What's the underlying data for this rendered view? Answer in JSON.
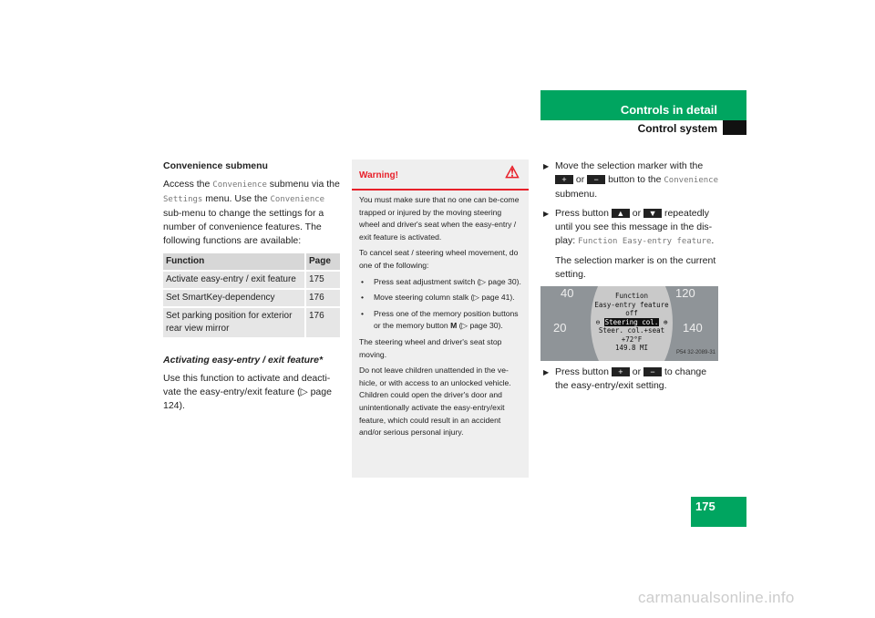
{
  "header": {
    "section": "Controls in detail",
    "subsection": "Control system"
  },
  "page_number": "175",
  "left": {
    "heading": "Convenience submenu",
    "intro": {
      "a": "Access the ",
      "m1": "Convenience",
      "b": " submenu via the ",
      "m2": "Settings",
      "c": " menu. Use the ",
      "m3": "Convenience",
      "d": " sub-menu to change the settings for a number of convenience features. The following functions are available:"
    },
    "table": {
      "headers": [
        "Function",
        "Page"
      ],
      "rows": [
        [
          "Activate easy-entry / exit feature",
          "175"
        ],
        [
          "Set SmartKey-dependency",
          "176"
        ],
        [
          "Set parking position for exterior rear view mirror",
          "176"
        ]
      ]
    },
    "subheading": "Activating easy-entry / exit feature",
    "subheading_mark": "*",
    "body": "Use this function to activate and deacti-vate the easy-entry/exit feature (▷ page 124)."
  },
  "warning": {
    "title": "Warning!",
    "icon": "warning-triangle-icon",
    "p1": "You must make sure that no one can be-come trapped or injured by the moving steering wheel and driver's seat when the easy-entry / exit feature is activated.",
    "p2": "To cancel seat / steering wheel movement, do one of the following:",
    "bullets": [
      "Press seat adjustment switch (▷ page 30).",
      "Move steering column stalk (▷ page 41).",
      "Press one of the memory position buttons or the memory button "
    ],
    "bullet3_bold": "M",
    "bullet3_end": " (▷ page 30).",
    "p3": "The steering wheel and driver's seat stop moving.",
    "p4": "Do not leave children unattended in the ve-hicle, or with access to an unlocked vehicle. Children could open the driver's door and unintentionally activate the easy-entry/exit feature, which could result in an accident and/or serious personal injury."
  },
  "right": {
    "step1": {
      "a": "Move the selection marker with the ",
      "plus": "+",
      "or": " or ",
      "minus": "−",
      "b": " button to the ",
      "menu": "Convenience",
      "c": " submenu."
    },
    "step2": {
      "a": "Press button ",
      "up": "▲",
      "or": " or ",
      "down": "▼",
      "b": " repeatedly until you see this message in the dis-play: ",
      "msg": "Function Easy-entry feature",
      "c": "."
    },
    "note": "The selection marker is on the current setting.",
    "display": {
      "l1": "Function",
      "l2": "Easy-entry feature",
      "l3": "off",
      "l4": "Steering col.",
      "l5": "Steer. col.+seat",
      "l6": "+72°F",
      "l7": "149.8 MI",
      "gauge": [
        "40",
        "20",
        "120",
        "140"
      ],
      "code": "P54 32-2089-31"
    },
    "step3": {
      "a": "Press button ",
      "plus": "+",
      "or": " or ",
      "minus": "−",
      "b": " to change the easy-entry/exit setting."
    }
  },
  "watermark": "carmanualsonline.info",
  "colors": {
    "brand": "#00a560",
    "warning": "#e8202a"
  }
}
